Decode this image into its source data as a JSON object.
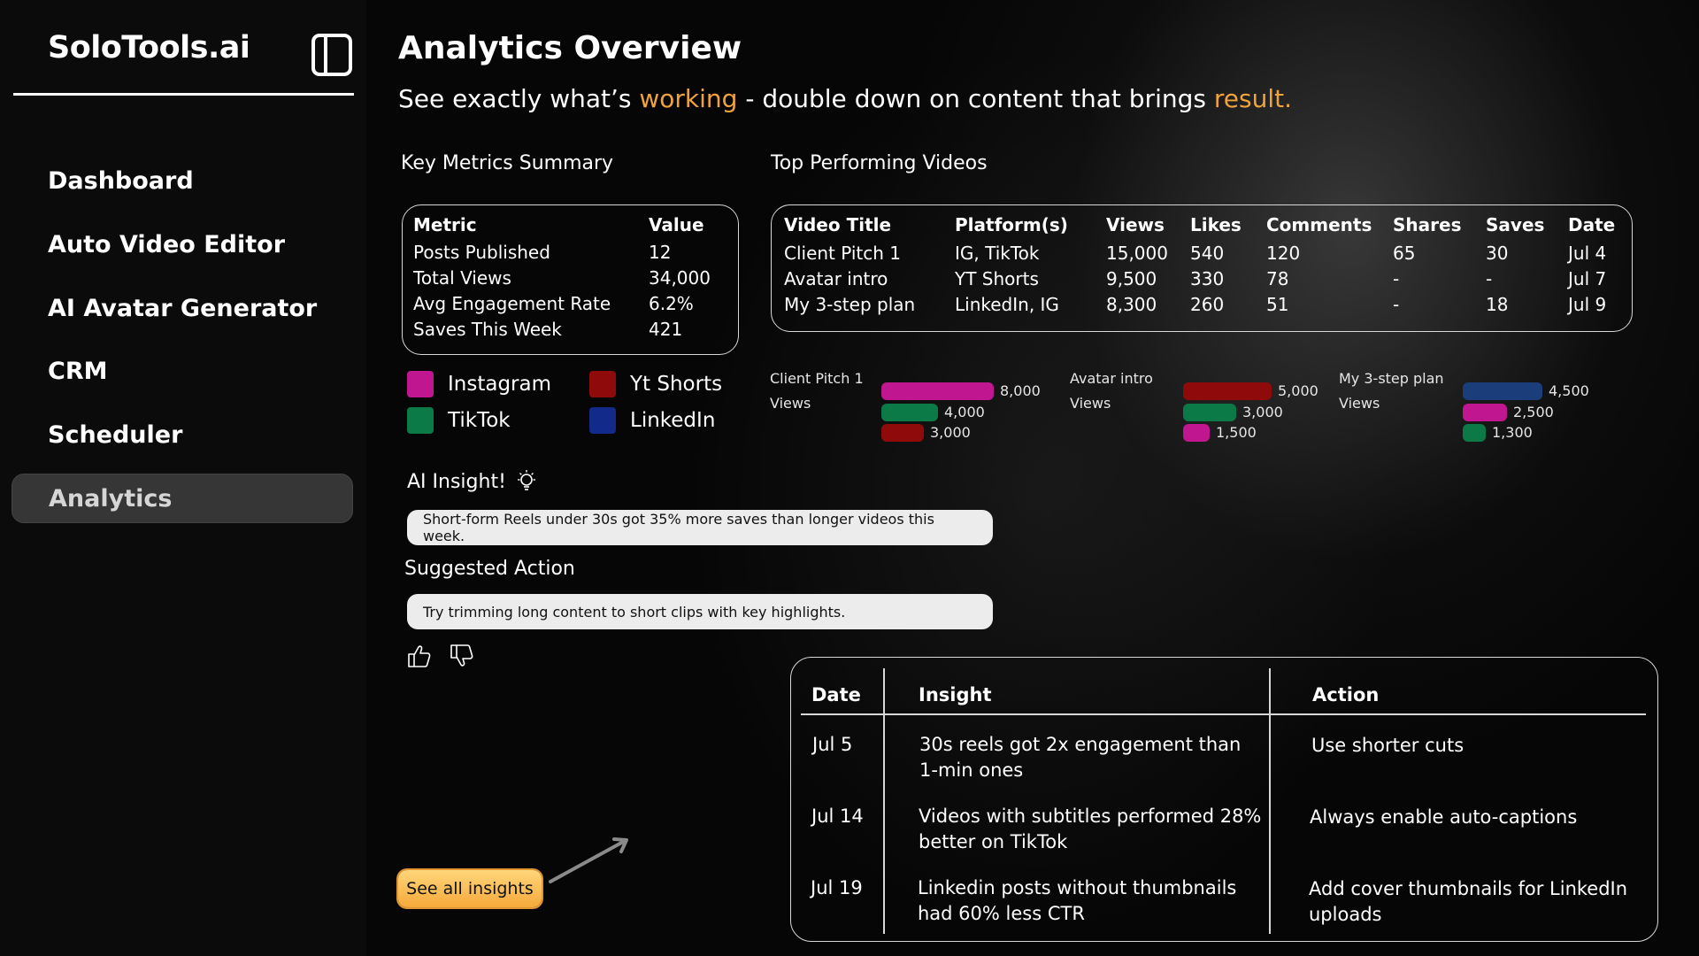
{
  "app": {
    "brand": "SoloTools.ai",
    "toggle_icon": "sidebar-toggle-icon"
  },
  "sidebar": {
    "items": [
      {
        "label": "Dashboard",
        "active": false
      },
      {
        "label": "Auto Video Editor",
        "active": false
      },
      {
        "label": "AI Avatar Generator",
        "active": false
      },
      {
        "label": "CRM",
        "active": false
      },
      {
        "label": "Scheduler",
        "active": false
      },
      {
        "label": "Analytics",
        "active": true
      }
    ]
  },
  "header": {
    "title": "Analytics Overview",
    "subtitle_part1": "See exactly what’s ",
    "subtitle_highlight1": "working",
    "subtitle_part2": " - double down on content that brings ",
    "subtitle_highlight2": "result.",
    "accent_color": "#f0a33c"
  },
  "key_metrics": {
    "section_title": "Key Metrics Summary",
    "headers": [
      "Metric",
      "Value"
    ],
    "rows": [
      [
        "Posts Published",
        "12"
      ],
      [
        "Total Views",
        "34,000"
      ],
      [
        "Avg Engagement Rate",
        "6.2%"
      ],
      [
        "Saves This Week",
        "421"
      ]
    ]
  },
  "legend": [
    {
      "label": "Instagram",
      "color": "#c0168f"
    },
    {
      "label": "Yt Shorts",
      "color": "#8f0b0b"
    },
    {
      "label": "TikTok",
      "color": "#0c7a46"
    },
    {
      "label": "LinkedIn",
      "color": "#122a8a"
    }
  ],
  "top_videos": {
    "section_title": "Top Performing Videos",
    "headers": [
      "Video Title",
      "Platform(s)",
      "Views",
      "Likes",
      "Comments",
      "Shares",
      "Saves",
      "Date"
    ],
    "rows": [
      [
        "Client Pitch 1",
        "IG, TikTok",
        "15,000",
        "540",
        "120",
        "65",
        "30",
        "Jul 4"
      ],
      [
        "Avatar intro",
        "YT Shorts",
        "9,500",
        "330",
        "78",
        "-",
        "-",
        "Jul 7"
      ],
      [
        "My 3-step plan",
        "LinkedIn, IG",
        "8,300",
        "260",
        "51",
        "-",
        "18",
        "Jul 9"
      ]
    ]
  },
  "chart_data": [
    {
      "type": "bar",
      "title": "Client Pitch 1",
      "ylabel": "Views",
      "categories": [
        "Instagram",
        "TikTok",
        "Yt Shorts"
      ],
      "values": [
        8000,
        4000,
        3000
      ],
      "labels": [
        "8,000",
        "4,000",
        "3,000"
      ],
      "colors": [
        "#c0168f",
        "#0c7a46",
        "#8f0b0b"
      ]
    },
    {
      "type": "bar",
      "title": "Avatar intro",
      "ylabel": "Views",
      "categories": [
        "Yt Shorts",
        "TikTok",
        "Instagram"
      ],
      "values": [
        5000,
        3000,
        1500
      ],
      "labels": [
        "5,000",
        "3,000",
        "1,500"
      ],
      "colors": [
        "#8f0b0b",
        "#0c7a46",
        "#c0168f"
      ]
    },
    {
      "type": "bar",
      "title": "My 3-step plan",
      "ylabel": "Views",
      "categories": [
        "LinkedIn",
        "Instagram",
        "TikTok"
      ],
      "values": [
        4500,
        2500,
        1300
      ],
      "labels": [
        "4,500",
        "2,500",
        "1,300"
      ],
      "colors": [
        "#1b3d7a",
        "#c0168f",
        "#0c7a46"
      ]
    }
  ],
  "ai_insight": {
    "title": "AI Insight!",
    "icon": "lightbulb-icon",
    "text": "Short-form Reels under 30s got 35% more saves than longer videos this week."
  },
  "suggested_action": {
    "title": "Suggested Action",
    "text": "Try trimming long content to short clips with key highlights.",
    "thumbs_up_icon": "thumbs-up-icon",
    "thumbs_down_icon": "thumbs-down-icon"
  },
  "insights_table": {
    "headers": [
      "Date",
      "Insight",
      "Action"
    ],
    "rows": [
      {
        "date": "Jul 5",
        "insight_l1": "30s reels got 2x engagement than",
        "insight_l2": "1-min ones",
        "action_l1": "Use shorter cuts",
        "action_l2": ""
      },
      {
        "date": "Jul 14",
        "insight_l1": "Videos with subtitles performed 28%",
        "insight_l2": "better on TikTok",
        "action_l1": "Always enable auto-captions",
        "action_l2": ""
      },
      {
        "date": "Jul 19",
        "insight_l1": "Linkedin posts without thumbnails",
        "insight_l2": "had 60% less CTR",
        "action_l1": "Add cover thumbnails for LinkedIn",
        "action_l2": "uploads"
      }
    ]
  },
  "see_all_button": "See all insights"
}
